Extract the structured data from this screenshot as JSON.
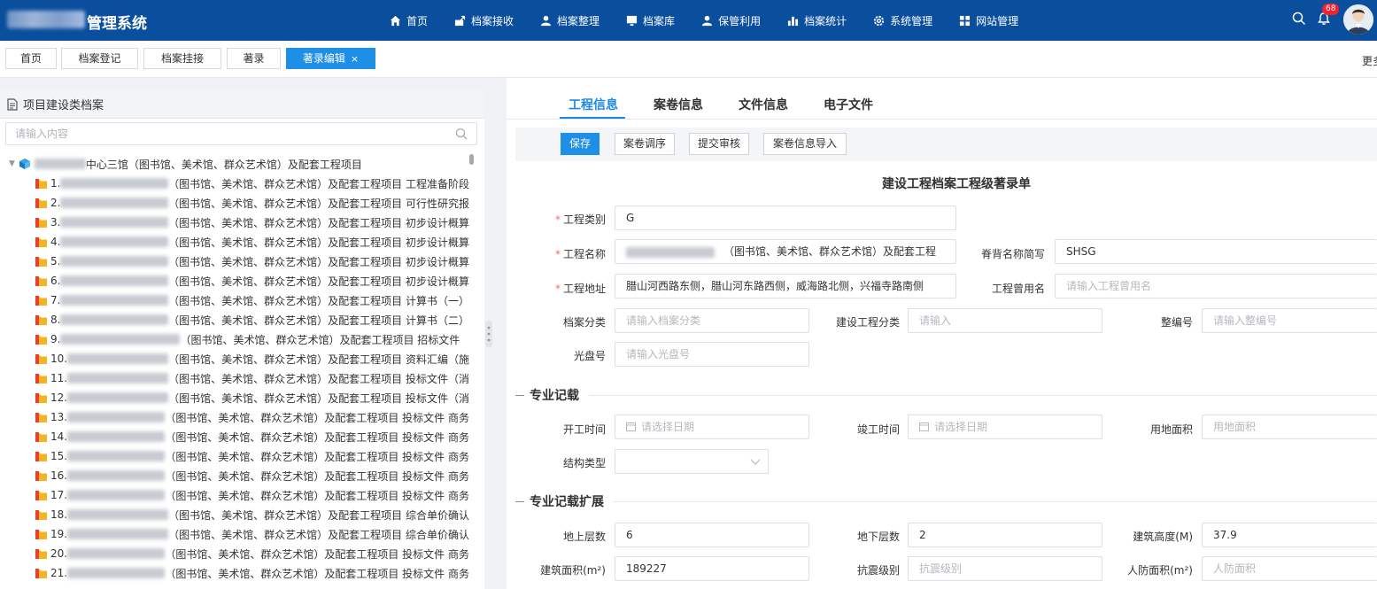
{
  "header": {
    "title": "管理系统",
    "nav": [
      {
        "label": "首页",
        "icon": "home-icon"
      },
      {
        "label": "档案接收",
        "icon": "receive-icon"
      },
      {
        "label": "档案整理",
        "icon": "user-icon"
      },
      {
        "label": "档案库",
        "icon": "monitor-icon"
      },
      {
        "label": "保管利用",
        "icon": "user-icon"
      },
      {
        "label": "档案统计",
        "icon": "bar-chart-icon"
      },
      {
        "label": "系统管理",
        "icon": "gear-icon"
      },
      {
        "label": "网站管理",
        "icon": "grid-icon"
      }
    ],
    "notification_count": "68"
  },
  "tabs": [
    {
      "label": "首页"
    },
    {
      "label": "档案登记"
    },
    {
      "label": "档案挂接"
    },
    {
      "label": "著录"
    },
    {
      "label": "著录编辑",
      "active": true,
      "close": "×"
    }
  ],
  "tabs_more": "更多",
  "left": {
    "title": "项目建设类档案",
    "search_placeholder": "请输入内容",
    "root_label": "中心三馆（图书馆、美术馆、群众艺术馆）及配套工程项目",
    "items": [
      {
        "num": "1.",
        "text": "（图书馆、美术馆、群众艺术馆）及配套工程项目 工程准备阶段"
      },
      {
        "num": "2.",
        "text": "（图书馆、美术馆、群众艺术馆）及配套工程项目 可行性研究报"
      },
      {
        "num": "3.",
        "text": "（图书馆、美术馆、群众艺术馆）及配套工程项目 初步设计概算"
      },
      {
        "num": "4.",
        "text": "（图书馆、美术馆、群众艺术馆）及配套工程项目 初步设计概算"
      },
      {
        "num": "5.",
        "text": "（图书馆、美术馆、群众艺术馆）及配套工程项目 初步设计概算"
      },
      {
        "num": "6.",
        "text": "（图书馆、美术馆、群众艺术馆）及配套工程项目 初步设计概算"
      },
      {
        "num": "7.",
        "text": "（图书馆、美术馆、群众艺术馆）及配套工程项目 计算书（一）"
      },
      {
        "num": "8.",
        "text": "（图书馆、美术馆、群众艺术馆）及配套工程项目 计算书（二）"
      },
      {
        "num": "9.",
        "text": "（图书馆、美术馆、群众艺术馆）及配套工程项目 招标文件"
      },
      {
        "num": "10.",
        "text": "（图书馆、美术馆、群众艺术馆）及配套工程项目 资料汇编（施"
      },
      {
        "num": "11.",
        "text": "（图书馆、美术馆、群众艺术馆）及配套工程项目 投标文件（消"
      },
      {
        "num": "12.",
        "text": "（图书馆、美术馆、群众艺术馆）及配套工程项目 投标文件（消"
      },
      {
        "num": "13.",
        "text": "（图书馆、美术馆、群众艺术馆）及配套工程项目 投标文件 商务"
      },
      {
        "num": "14.",
        "text": "（图书馆、美术馆、群众艺术馆）及配套工程项目 投标文件 商务"
      },
      {
        "num": "15.",
        "text": "（图书馆、美术馆、群众艺术馆）及配套工程项目 投标文件 商务"
      },
      {
        "num": "16.",
        "text": "（图书馆、美术馆、群众艺术馆）及配套工程项目 投标文件 商务"
      },
      {
        "num": "17.",
        "text": "（图书馆、美术馆、群众艺术馆）及配套工程项目 投标文件 商务"
      },
      {
        "num": "18.",
        "text": "（图书馆、美术馆、群众艺术馆）及配套工程项目 综合单价确认"
      },
      {
        "num": "19.",
        "text": "（图书馆、美术馆、群众艺术馆）及配套工程项目 综合单价确认"
      },
      {
        "num": "20.",
        "text": "（图书馆、美术馆、群众艺术馆）及配套工程项目 投标文件 商务"
      },
      {
        "num": "21.",
        "text": "（图书馆、美术馆、群众艺术馆）及配套工程项目 投标文件 商务"
      }
    ]
  },
  "right": {
    "tabs": [
      "工程信息",
      "案卷信息",
      "文件信息",
      "电子文件"
    ],
    "buttons": {
      "save": "保存",
      "reorder": "案卷调序",
      "submit": "提交审核",
      "import": "案卷信息导入"
    },
    "form_title": "建设工程档案工程级著录单",
    "fields": {
      "category": {
        "label": "工程类别",
        "value": "G"
      },
      "name": {
        "label": "工程名称",
        "value": "（图书馆、美术馆、群众艺术馆）及配套工程"
      },
      "spine_abbr": {
        "label": "脊背名称简写",
        "value": "SHSG"
      },
      "address": {
        "label": "工程地址",
        "value": "腊山河西路东侧，腊山河东路西侧，威海路北侧，兴福寺路南侧"
      },
      "former_name": {
        "label": "工程曾用名",
        "placeholder": "请输入工程曾用名"
      },
      "archive_class": {
        "label": "档案分类",
        "placeholder": "请输入档案分类"
      },
      "build_class": {
        "label": "建设工程分类",
        "placeholder": "请输入"
      },
      "whole_no": {
        "label": "整编号",
        "placeholder": "请输入整编号"
      },
      "disc_no": {
        "label": "光盘号",
        "placeholder": "请输入光盘号"
      }
    },
    "section1": "专业记载",
    "section1_fields": {
      "start": {
        "label": "开工时间",
        "placeholder": "请选择日期"
      },
      "end": {
        "label": "竣工时间",
        "placeholder": "请选择日期"
      },
      "land_area": {
        "label": "用地面积",
        "placeholder": "用地面积"
      },
      "structure": {
        "label": "结构类型"
      }
    },
    "section2": "专业记载扩展",
    "section2_fields": {
      "above": {
        "label": "地上层数",
        "value": "6"
      },
      "below": {
        "label": "地下层数",
        "value": "2"
      },
      "height": {
        "label": "建筑高度(M)",
        "value": "37.9"
      },
      "area": {
        "label": "建筑面积(m²)",
        "value": "189227"
      },
      "seismic": {
        "label": "抗震级别",
        "placeholder": "抗震级别"
      },
      "civil_area": {
        "label": "人防面积(m²)",
        "placeholder": "人防面积"
      }
    }
  }
}
